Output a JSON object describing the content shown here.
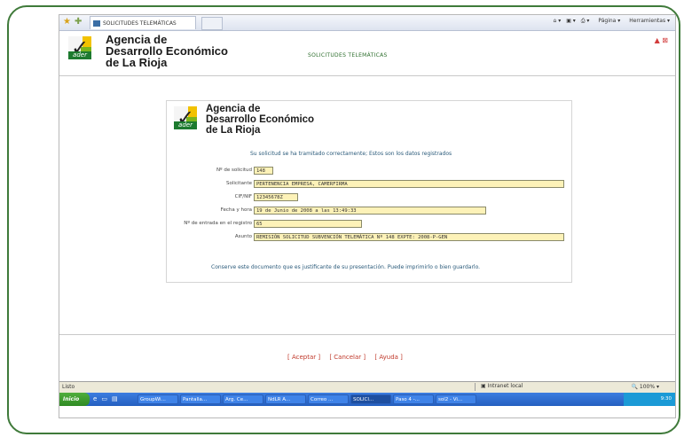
{
  "browser": {
    "tab_title": "SOLICITUDES TELEMÁTICAS",
    "commands": [
      "Página",
      "Herramientas"
    ]
  },
  "header": {
    "org_line1": "Agencia de",
    "org_line2": "Desarrollo Económico",
    "org_line3": "de La Rioja",
    "logo_text": "ader",
    "center_title": "SOLICITUDES TELEMÁTICAS"
  },
  "card": {
    "org_line1": "Agencia de",
    "org_line2": "Desarrollo Económico",
    "org_line3": "de La Rioja",
    "message": "Su solicitud se ha tramitado correctamente; Estos son los datos registrados",
    "fields": [
      {
        "label": "Nº de solicitud",
        "value": "148"
      },
      {
        "label": "Solicitante",
        "value": "PERTENENCIA EMPRESA, CAMERFIRMA"
      },
      {
        "label": "CIF/NIF",
        "value": "12345678Z"
      },
      {
        "label": "Fecha y hora",
        "value": "19 de Junio de 2008 a las 13:49:33"
      },
      {
        "label": "Nº de entrada en el registro",
        "value": "65"
      },
      {
        "label": "Asunto",
        "value": "REMISIÓN SOLICITUD SUBVENCIÓN TELEMÁTICA Nº 148 EXPTE: 2008-P-GEN"
      }
    ],
    "note": "Conserve este documento que es justificante de su presentación. Puede imprimirlo o bien guardarlo."
  },
  "actions": {
    "accept": "[ Aceptar ]",
    "cancel": "[ Cancelar ]",
    "help": "[ Ayuda ]"
  },
  "status": {
    "text": "Listo",
    "zone": "Intranet local",
    "zoom": "100%"
  },
  "taskbar": {
    "start": "Inicio",
    "items": [
      "GroupWi...",
      "Pantalla...",
      "Arg. Ce...",
      "NdLR A...",
      "Correo ...",
      "SOLICI...",
      "Paso 4 -...",
      "sol2 - Vi..."
    ],
    "clock": "9:30"
  },
  "colors": {
    "frame_border": "#3f7a3a",
    "input_bg": "#fdf2b8",
    "action_text": "#c0392b"
  }
}
